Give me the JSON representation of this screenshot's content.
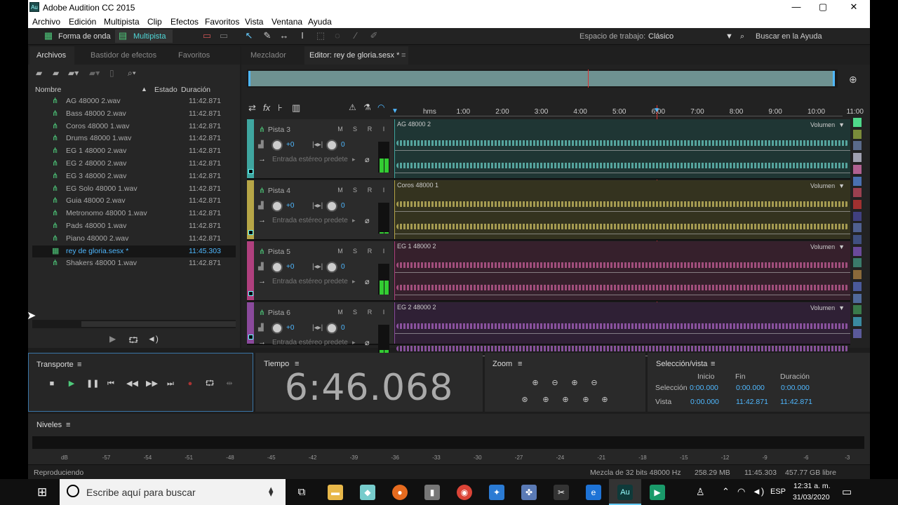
{
  "app": {
    "title": "Adobe Audition CC 2015",
    "logo": "Au"
  },
  "window_controls": {
    "minimize": "—",
    "maximize": "▢",
    "close": "✕"
  },
  "menu": [
    "Archivo",
    "Edición",
    "Multipista",
    "Clip",
    "Efectos",
    "Favoritos",
    "Vista",
    "Ventana",
    "Ayuda"
  ],
  "toolbar": {
    "waveform_label": "Forma de onda",
    "multitrack_label": "Multipista",
    "workspace_label": "Espacio de trabajo:",
    "workspace_value": "Clásico",
    "help_search": "Buscar en la Ayuda"
  },
  "files_panel": {
    "tabs": [
      "Archivos",
      "Bastidor de efectos",
      "Favoritos"
    ],
    "columns": {
      "name": "Nombre",
      "status": "Estado",
      "duration": "Duración"
    },
    "files": [
      {
        "name": "AG 48000 2.wav",
        "duration": "11:42.871"
      },
      {
        "name": "Bass 48000 2.wav",
        "duration": "11:42.871"
      },
      {
        "name": "Coros 48000 1.wav",
        "duration": "11:42.871"
      },
      {
        "name": "Drums 48000 1.wav",
        "duration": "11:42.871"
      },
      {
        "name": "EG 1 48000 2.wav",
        "duration": "11:42.871"
      },
      {
        "name": "EG 2 48000 2.wav",
        "duration": "11:42.871"
      },
      {
        "name": "EG 3 48000 2.wav",
        "duration": "11:42.871"
      },
      {
        "name": "EG Solo 48000 1.wav",
        "duration": "11:42.871"
      },
      {
        "name": "Guia 48000 2.wav",
        "duration": "11:42.871"
      },
      {
        "name": "Metronomo 48000 1.wav",
        "duration": "11:42.871"
      },
      {
        "name": "Pads 48000 1.wav",
        "duration": "11:42.871"
      },
      {
        "name": "Piano 48000 2.wav",
        "duration": "11:42.871"
      },
      {
        "name": "rey de gloria.sesx *",
        "duration": "11:45.303",
        "selected": true
      },
      {
        "name": "Shakers 48000 1.wav",
        "duration": "11:42.871"
      }
    ]
  },
  "editor": {
    "tabs": [
      "Mezclador",
      "Editor: rey de gloria.sesx *"
    ],
    "ruler": [
      "hms",
      "1:00",
      "2:00",
      "3:00",
      "4:00",
      "5:00",
      "6:00",
      "7:00",
      "8:00",
      "9:00",
      "10:00",
      "11:00"
    ],
    "playhead_fraction": 0.577,
    "tracks": [
      {
        "name": "Pista 3",
        "clip": "AG 48000 2",
        "color": "#3fa6a0",
        "lane": "#1f3634",
        "wave": "#5fb8b0",
        "meter": 0.5
      },
      {
        "name": "Pista 4",
        "clip": "Coros 48000 1",
        "color": "#b7a647",
        "lane": "#34331f",
        "wave": "#b9ad5a",
        "meter": 0.05
      },
      {
        "name": "Pista 5",
        "clip": "EG 1 48000 2",
        "color": "#b0407e",
        "lane": "#36202c",
        "wave": "#b4568a",
        "meter": 0.5
      },
      {
        "name": "Pista 6",
        "clip": "EG 2 48000 2",
        "color": "#8a4a9c",
        "lane": "#2f2035",
        "wave": "#9a5ab0",
        "meter": 0.2
      }
    ],
    "track_controls": {
      "m": "M",
      "s": "S",
      "r": "R",
      "i": "I",
      "pan": "+0",
      "vol": "0",
      "input": "Entrada estéreo predete",
      "volume_label": "Volumen"
    }
  },
  "transport": {
    "title": "Transporte"
  },
  "time": {
    "title": "Tiempo",
    "value": "6:46.068"
  },
  "zoom": {
    "title": "Zoom"
  },
  "selection": {
    "title": "Selección/vista",
    "headers": [
      "Inicio",
      "Fin",
      "Duración"
    ],
    "rows": [
      {
        "label": "Selección",
        "start": "0:00.000",
        "end": "0:00.000",
        "duration": "0:00.000"
      },
      {
        "label": "Vista",
        "start": "0:00.000",
        "end": "11:42.871",
        "duration": "11:42.871"
      }
    ]
  },
  "levels": {
    "title": "Niveles",
    "scale": [
      "dB",
      "-57",
      "-54",
      "-51",
      "-48",
      "-45",
      "-42",
      "-39",
      "-36",
      "-33",
      "-30",
      "-27",
      "-24",
      "-21",
      "-18",
      "-15",
      "-12",
      "-9",
      "-6",
      "-3",
      "0"
    ]
  },
  "status": {
    "left": "Reproduciendo",
    "mix": "Mezcla de 32 bits 48000 Hz",
    "memory": "258.29 MB",
    "duration": "11:45.303",
    "free": "457.77 GB libre"
  },
  "taskbar": {
    "search_placeholder": "Escribe aquí para buscar",
    "lang": "ESP",
    "time": "12:31 a. m.",
    "date": "31/03/2020"
  }
}
